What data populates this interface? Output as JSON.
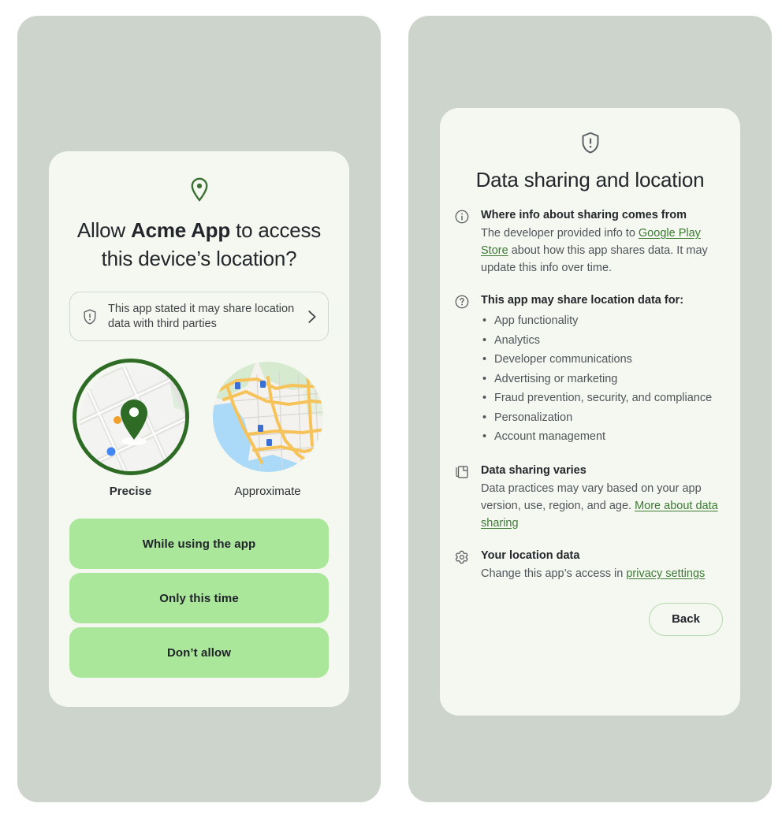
{
  "colors": {
    "frame_background": "#ccd4cc",
    "card_background": "#f4f8f1",
    "accent_green": "#2e6b25",
    "button_green": "#abe79a",
    "link_green": "#3c7a33",
    "text_primary": "#23262a",
    "text_secondary": "#50555a"
  },
  "permission_screen": {
    "header_icon": "location-pin-icon",
    "title_prefix": "Allow ",
    "title_app": "Acme App",
    "title_suffix": " to access this device’s location?",
    "share_notice": {
      "icon": "shield-warning-icon",
      "text": "This app stated it may share location data with third parties",
      "chevron": "chevron-right-icon"
    },
    "map_choices": [
      {
        "label": "Precise",
        "selected": true,
        "icon": "precise-map-thumbnail"
      },
      {
        "label": "Approximate",
        "selected": false,
        "icon": "approximate-map-thumbnail"
      }
    ],
    "buttons": [
      {
        "label": "While using the app"
      },
      {
        "label": "Only this time"
      },
      {
        "label": "Don’t allow"
      }
    ]
  },
  "details_screen": {
    "header_icon": "shield-warning-icon",
    "title": "Data sharing and location",
    "sections": [
      {
        "icon": "info-circle-icon",
        "heading": "Where info about sharing comes from",
        "paragraph_parts": [
          {
            "type": "text",
            "value": "The developer provided info to "
          },
          {
            "type": "link",
            "value": "Google Play Store"
          },
          {
            "type": "text",
            "value": " about how this app shares data. It may update this info over time."
          }
        ]
      },
      {
        "icon": "help-circle-icon",
        "heading": "This app may share location data for:",
        "bullets": [
          "App functionality",
          "Analytics",
          "Developer communications",
          "Advertising or marketing",
          "Fraud prevention, security, and compliance",
          "Personalization",
          "Account management"
        ]
      },
      {
        "icon": "copy-pages-icon",
        "heading": "Data sharing varies",
        "paragraph_parts": [
          {
            "type": "text",
            "value": "Data practices may vary based on your app version, use, region, and age. "
          },
          {
            "type": "link",
            "value": "More about data sharing"
          }
        ]
      },
      {
        "icon": "settings-gear-icon",
        "heading": "Your location data",
        "paragraph_parts": [
          {
            "type": "text",
            "value": "Change this app’s access in "
          },
          {
            "type": "link",
            "value": "privacy settings"
          }
        ]
      }
    ],
    "back_button": {
      "label": "Back"
    }
  }
}
